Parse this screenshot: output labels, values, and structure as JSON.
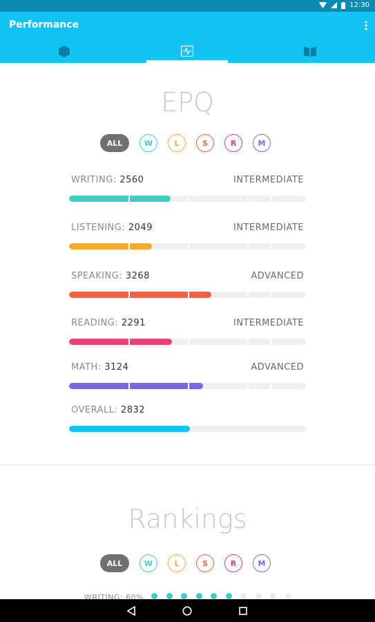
{
  "status_bar": {
    "time": "12:30"
  },
  "app_bar": {
    "title": "Performance"
  },
  "tabs": [
    {
      "icon": "hexagon-icon"
    },
    {
      "icon": "pulse-icon",
      "selected": true
    },
    {
      "icon": "book-icon"
    }
  ],
  "epq": {
    "title": "EPQ",
    "filters": [
      "ALL",
      "W",
      "L",
      "S",
      "R",
      "M"
    ],
    "metrics": [
      {
        "label": "WRITING:",
        "value": "2560",
        "level": "INTERMEDIATE",
        "progress": 0.43,
        "color": "#3ecfc2"
      },
      {
        "label": "LISTENING:",
        "value": "2049",
        "level": "INTERMEDIATE",
        "progress": 0.35,
        "color": "#f5a833"
      },
      {
        "label": "SPEAKING:",
        "value": "3268",
        "level": "ADVANCED",
        "progress": 0.6,
        "color": "#f1613f"
      },
      {
        "label": "READING:",
        "value": "2291",
        "level": "INTERMEDIATE",
        "progress": 0.435,
        "color": "#f03f7a"
      },
      {
        "label": "MATH:",
        "value": "3124",
        "level": "ADVANCED",
        "progress": 0.565,
        "color": "#7868e6"
      },
      {
        "label": "OVERALL:",
        "value": "2832",
        "level": "",
        "progress": 0.51,
        "color": "#11c4f1"
      }
    ]
  },
  "rankings": {
    "title": "Rankings",
    "filters": [
      "ALL",
      "W",
      "L",
      "S",
      "R",
      "M"
    ],
    "peek_label": "WRITING: 60%",
    "dots_total": 10,
    "dots_filled": 6
  },
  "colors": {
    "W": "#3ecfc2",
    "L": "#f5a833",
    "S": "#f1613f",
    "R": "#f03f7a",
    "M": "#7868e6",
    "accent": "#11c4f1"
  }
}
